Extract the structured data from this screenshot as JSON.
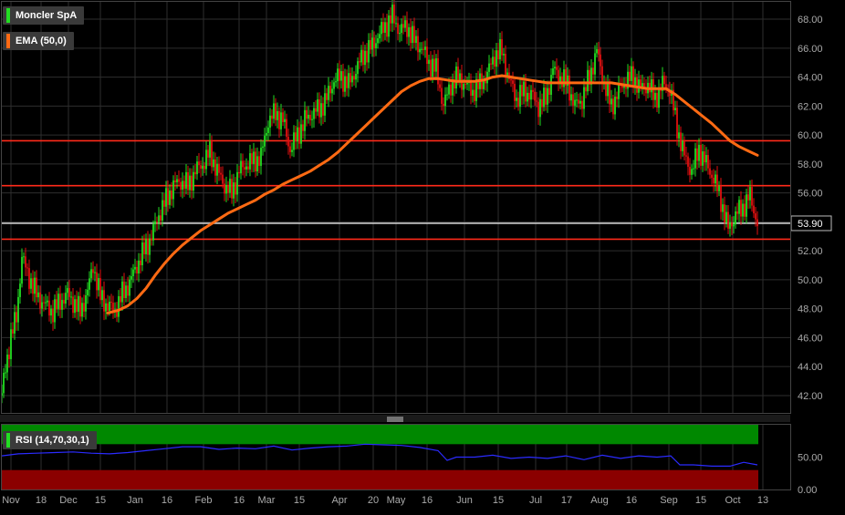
{
  "chart_data": [
    {
      "type": "line",
      "subtype": "candlestick",
      "legend": [
        {
          "name": "Moncler SpA",
          "color": "#22dd22"
        },
        {
          "name": "EMA (50,0)",
          "color": "#ff6a13"
        }
      ],
      "current_price": "53.90",
      "y_ticks": [
        "42.00",
        "44.00",
        "46.00",
        "48.00",
        "50.00",
        "52.00",
        "54.00",
        "56.00",
        "58.00",
        "60.00",
        "62.00",
        "64.00",
        "66.00",
        "68.00"
      ],
      "ylim": [
        40.8,
        69.2
      ],
      "x_ticks": [
        "Nov",
        "18",
        "Dec",
        "15",
        "Jan",
        "16",
        "Feb",
        "16",
        "Mar",
        "15",
        "Apr",
        "20",
        "May",
        "16",
        "Jun",
        "15",
        "Jul",
        "17",
        "Aug",
        "16",
        "Sep",
        "15",
        "Oct",
        "13"
      ],
      "x_tick_positions": [
        12,
        45,
        75,
        110,
        148,
        183,
        223,
        262,
        292,
        328,
        372,
        409,
        434,
        468,
        509,
        546,
        587,
        621,
        657,
        692,
        733,
        768,
        803,
        836
      ],
      "horizontal_levels": [
        {
          "value": 59.6,
          "color": "#ff2a1a"
        },
        {
          "value": 56.5,
          "color": "#ff2a1a"
        },
        {
          "value": 53.9,
          "color": "#cccccc"
        },
        {
          "value": 52.8,
          "color": "#ff2a1a"
        }
      ],
      "price_path": [
        [
          2,
          42
        ],
        [
          6,
          44
        ],
        [
          12,
          46
        ],
        [
          18,
          47.5
        ],
        [
          24,
          51.5
        ],
        [
          30,
          50.5
        ],
        [
          36,
          49.5
        ],
        [
          42,
          48.8
        ],
        [
          50,
          48.2
        ],
        [
          58,
          47.8
        ],
        [
          66,
          48.5
        ],
        [
          74,
          49.0
        ],
        [
          80,
          48.5
        ],
        [
          88,
          47.8
        ],
        [
          96,
          49.2
        ],
        [
          102,
          51.0
        ],
        [
          110,
          48.8
        ],
        [
          118,
          48.2
        ],
        [
          126,
          47.9
        ],
        [
          134,
          49.0
        ],
        [
          142,
          49.8
        ],
        [
          150,
          51.0
        ],
        [
          158,
          52.0
        ],
        [
          166,
          53.0
        ],
        [
          174,
          54.5
        ],
        [
          182,
          55.5
        ],
        [
          190,
          56.5
        ],
        [
          198,
          56.8
        ],
        [
          206,
          56.5
        ],
        [
          214,
          57.5
        ],
        [
          222,
          58.0
        ],
        [
          230,
          58.8
        ],
        [
          238,
          57.5
        ],
        [
          246,
          56.5
        ],
        [
          254,
          56.0
        ],
        [
          262,
          57.5
        ],
        [
          270,
          58.0
        ],
        [
          278,
          58.2
        ],
        [
          286,
          58.5
        ],
        [
          294,
          61.0
        ],
        [
          302,
          61.5
        ],
        [
          310,
          61.0
        ],
        [
          318,
          59.0
        ],
        [
          326,
          60.0
        ],
        [
          334,
          61.0
        ],
        [
          342,
          61.5
        ],
        [
          350,
          61.8
        ],
        [
          358,
          62.5
        ],
        [
          366,
          63.8
        ],
        [
          374,
          64.0
        ],
        [
          382,
          63.5
        ],
        [
          390,
          64.5
        ],
        [
          398,
          65.5
        ],
        [
          406,
          66.0
        ],
        [
          414,
          66.8
        ],
        [
          422,
          67.5
        ],
        [
          430,
          68.2
        ],
        [
          438,
          67.2
        ],
        [
          446,
          67.5
        ],
        [
          454,
          66.5
        ],
        [
          462,
          66.0
        ],
        [
          470,
          65.0
        ],
        [
          478,
          64.5
        ],
        [
          486,
          62.0
        ],
        [
          494,
          63.5
        ],
        [
          502,
          64.0
        ],
        [
          510,
          63.5
        ],
        [
          518,
          63.0
        ],
        [
          526,
          63.5
        ],
        [
          534,
          64.2
        ],
        [
          542,
          65.5
        ],
        [
          550,
          65.8
        ],
        [
          558,
          63.8
        ],
        [
          566,
          62.5
        ],
        [
          574,
          63.0
        ],
        [
          582,
          62.8
        ],
        [
          590,
          62.0
        ],
        [
          598,
          62.5
        ],
        [
          606,
          64.5
        ],
        [
          614,
          64.0
        ],
        [
          622,
          63.5
        ],
        [
          630,
          62.0
        ],
        [
          638,
          62.5
        ],
        [
          646,
          64.0
        ],
        [
          654,
          65.8
        ],
        [
          662,
          63.5
        ],
        [
          670,
          62.0
        ],
        [
          678,
          63.0
        ],
        [
          686,
          63.8
        ],
        [
          694,
          64.0
        ],
        [
          702,
          63.2
        ],
        [
          710,
          63.5
        ],
        [
          718,
          62.5
        ],
        [
          726,
          63.5
        ],
        [
          734,
          63.2
        ],
        [
          742,
          60.5
        ],
        [
          750,
          58.5
        ],
        [
          758,
          57.5
        ],
        [
          766,
          59.0
        ],
        [
          774,
          58.0
        ],
        [
          782,
          57.0
        ],
        [
          790,
          55.5
        ],
        [
          798,
          53.5
        ],
        [
          806,
          54.5
        ],
        [
          814,
          55.0
        ],
        [
          822,
          55.8
        ],
        [
          830,
          53.9
        ]
      ],
      "ema_path": [
        [
          118,
          47.7
        ],
        [
          130,
          47.9
        ],
        [
          140,
          48.2
        ],
        [
          150,
          48.7
        ],
        [
          160,
          49.4
        ],
        [
          170,
          50.3
        ],
        [
          180,
          51.1
        ],
        [
          190,
          51.8
        ],
        [
          200,
          52.4
        ],
        [
          210,
          52.9
        ],
        [
          220,
          53.4
        ],
        [
          230,
          53.8
        ],
        [
          240,
          54.2
        ],
        [
          250,
          54.6
        ],
        [
          260,
          54.9
        ],
        [
          270,
          55.2
        ],
        [
          280,
          55.5
        ],
        [
          290,
          55.9
        ],
        [
          300,
          56.2
        ],
        [
          310,
          56.6
        ],
        [
          320,
          56.9
        ],
        [
          330,
          57.2
        ],
        [
          340,
          57.5
        ],
        [
          350,
          57.9
        ],
        [
          360,
          58.3
        ],
        [
          370,
          58.8
        ],
        [
          380,
          59.4
        ],
        [
          390,
          60.0
        ],
        [
          400,
          60.6
        ],
        [
          410,
          61.2
        ],
        [
          420,
          61.8
        ],
        [
          430,
          62.4
        ],
        [
          440,
          63.0
        ],
        [
          450,
          63.4
        ],
        [
          460,
          63.7
        ],
        [
          470,
          63.9
        ],
        [
          480,
          63.9
        ],
        [
          490,
          63.8
        ],
        [
          500,
          63.7
        ],
        [
          510,
          63.7
        ],
        [
          520,
          63.7
        ],
        [
          530,
          63.8
        ],
        [
          540,
          64.0
        ],
        [
          550,
          64.1
        ],
        [
          560,
          64.0
        ],
        [
          570,
          63.9
        ],
        [
          580,
          63.8
        ],
        [
          590,
          63.7
        ],
        [
          600,
          63.6
        ],
        [
          610,
          63.6
        ],
        [
          620,
          63.6
        ],
        [
          630,
          63.6
        ],
        [
          640,
          63.6
        ],
        [
          650,
          63.6
        ],
        [
          660,
          63.6
        ],
        [
          670,
          63.6
        ],
        [
          680,
          63.5
        ],
        [
          690,
          63.4
        ],
        [
          700,
          63.3
        ],
        [
          710,
          63.2
        ],
        [
          720,
          63.2
        ],
        [
          730,
          63.2
        ],
        [
          740,
          62.8
        ],
        [
          750,
          62.3
        ],
        [
          760,
          61.8
        ],
        [
          770,
          61.3
        ],
        [
          780,
          60.8
        ],
        [
          790,
          60.2
        ],
        [
          800,
          59.6
        ],
        [
          810,
          59.2
        ],
        [
          820,
          58.9
        ],
        [
          830,
          58.6
        ]
      ]
    },
    {
      "type": "line",
      "legend": [
        {
          "name": "RSI (14,70,30,1)",
          "color": "#22dd22"
        }
      ],
      "y_ticks": [
        "50.00",
        "0.00"
      ],
      "ylim": [
        0,
        100
      ],
      "overbought": 70,
      "oversold": 30,
      "bands": [
        {
          "from": 70,
          "to": 100,
          "color": "#008800"
        },
        {
          "from": 0,
          "to": 30,
          "color": "#8b0000"
        }
      ],
      "line_color": "#2b2bff",
      "rsi_path": [
        [
          2,
          52
        ],
        [
          20,
          55
        ],
        [
          40,
          56
        ],
        [
          60,
          57
        ],
        [
          80,
          58
        ],
        [
          100,
          56
        ],
        [
          120,
          55
        ],
        [
          140,
          57
        ],
        [
          160,
          60
        ],
        [
          180,
          63
        ],
        [
          200,
          66
        ],
        [
          220,
          66
        ],
        [
          240,
          62
        ],
        [
          260,
          64
        ],
        [
          280,
          63
        ],
        [
          300,
          67
        ],
        [
          320,
          61
        ],
        [
          340,
          64
        ],
        [
          360,
          66
        ],
        [
          380,
          67
        ],
        [
          400,
          70
        ],
        [
          420,
          69
        ],
        [
          440,
          68
        ],
        [
          460,
          65
        ],
        [
          480,
          60
        ],
        [
          490,
          45
        ],
        [
          500,
          50
        ],
        [
          520,
          50
        ],
        [
          540,
          53
        ],
        [
          560,
          48
        ],
        [
          580,
          50
        ],
        [
          600,
          48
        ],
        [
          620,
          52
        ],
        [
          640,
          46
        ],
        [
          660,
          53
        ],
        [
          680,
          48
        ],
        [
          700,
          52
        ],
        [
          720,
          50
        ],
        [
          735,
          52
        ],
        [
          745,
          38
        ],
        [
          760,
          38
        ],
        [
          780,
          36
        ],
        [
          800,
          36
        ],
        [
          815,
          42
        ],
        [
          830,
          38
        ]
      ]
    }
  ]
}
